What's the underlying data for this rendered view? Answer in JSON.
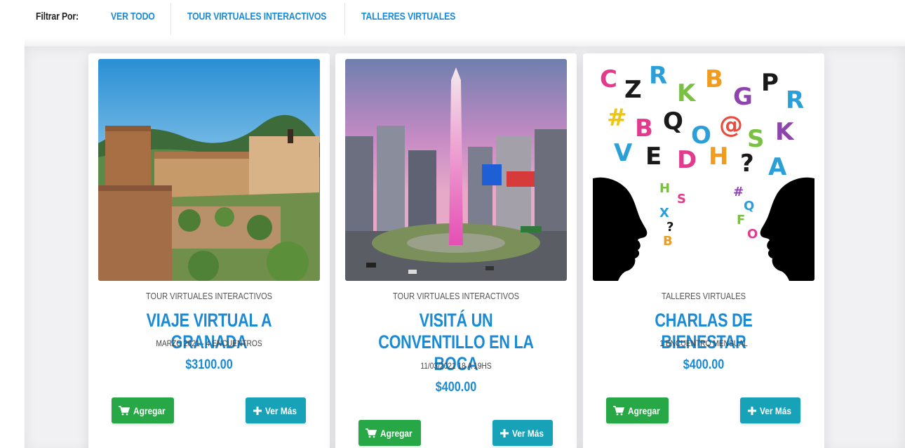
{
  "filter": {
    "label": "Filtrar Por:",
    "options": [
      "VER TODO",
      "TOUR VIRTUALES INTERACTIVOS",
      "TALLERES VIRTUALES"
    ]
  },
  "cards": [
    {
      "category": "TOUR VIRTUALES INTERACTIVOS",
      "title": "VIAJE VIRTUAL A GRANADA",
      "subtitle": "MARZO 2021 - 4 ENCUENTROS",
      "price": "$3100.00",
      "add_label": "Agregar",
      "more_label": "Ver Más",
      "image": "alhambra-granada-photo"
    },
    {
      "category": "TOUR VIRTUALES INTERACTIVOS",
      "title": "VISITÁ UN CONVENTILLO EN LA BOCA",
      "subtitle": "11/03/2021 18 A 19HS",
      "price": "$400.00",
      "add_label": "Agregar",
      "more_label": "Ver Más",
      "image": "obelisco-buenos-aires-photo"
    },
    {
      "category": "TALLERES VIRTUALES",
      "title": "CHARLAS DE BIENESTAR",
      "subtitle": "1 ENCUENTRO MENSUAL",
      "price": "$400.00",
      "add_label": "Agregar",
      "more_label": "Ver Más",
      "image": "talking-heads-letters-illustration"
    }
  ],
  "icons": {
    "add": "cart-icon",
    "more": "plus-icon"
  },
  "colors": {
    "accent": "#1a8ad4",
    "add_button": "#27a745",
    "more_button": "#17a2b8"
  }
}
